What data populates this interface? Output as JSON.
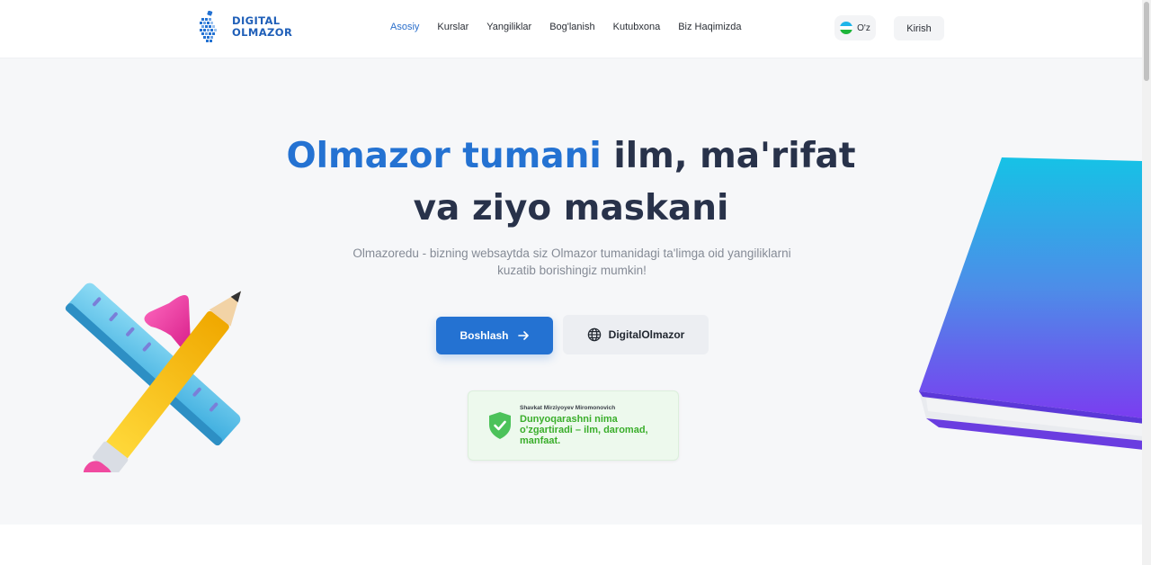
{
  "header": {
    "logo_line1": "DIGITAL",
    "logo_line2": "OLMAZOR",
    "nav": [
      {
        "label": "Asosiy",
        "active": true
      },
      {
        "label": "Kurslar",
        "active": false
      },
      {
        "label": "Yangiliklar",
        "active": false
      },
      {
        "label": "Bog'lanish",
        "active": false
      },
      {
        "label": "Kutubxona",
        "active": false
      },
      {
        "label": "Biz Haqimizda",
        "active": false
      }
    ],
    "lang": "O'z",
    "login": "Kirish"
  },
  "hero": {
    "title_accent": "Olmazor tumani",
    "title_rest": " ilm, ma'rifat",
    "title_line2": "va ziyo maskani",
    "subtitle": "Olmazoredu - bizning websaytda siz Olmazor tumanidagi ta'limga oid yangiliklarni kuzatib borishingiz mumkin!",
    "primary_button": "Boshlash",
    "secondary_button": "DigitalOlmazor",
    "quote_author": "Shavkat Mirziyoyev Miromonovich",
    "quote_text": "Dunyoqarashni nima o'zgartiradi – ilm, daromad, manfaat."
  },
  "colors": {
    "accent": "#2472d2",
    "title": "#28324a",
    "quote_green": "#3aae2b"
  },
  "icons": [
    "logo-icon",
    "flag-icon",
    "arrow-right-icon",
    "globe-icon",
    "shield-check-icon",
    "ruler-pencil-illustration",
    "book-illustration"
  ]
}
